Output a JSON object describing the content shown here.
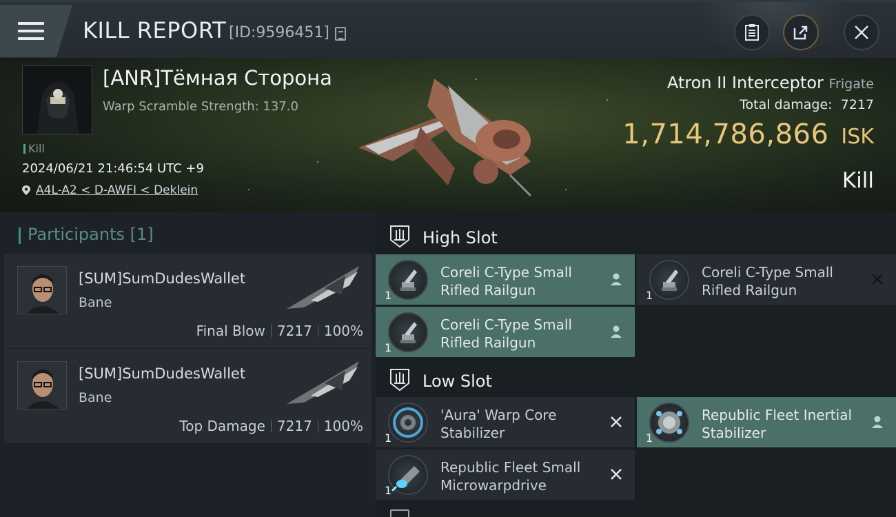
{
  "header": {
    "title": "KILL REPORT",
    "kill_id": "[ID:9596451]",
    "menu_icon": "hamburger-menu-icon",
    "buttons": [
      {
        "icon": "clipboard-icon"
      },
      {
        "icon": "share-icon"
      },
      {
        "icon": "close-icon"
      }
    ]
  },
  "victim": {
    "name": "[ANR]Тёмная Сторона",
    "subtitle": "Warp Scramble Strength: 137.0",
    "kill_tag": "Kill",
    "timestamp": "2024/06/21 21:46:54 UTC +9",
    "location": "A4L-A2 < D-AWFI < Deklein",
    "ship_name": "Atron II Interceptor",
    "ship_class": "Frigate",
    "total_damage_label": "Total damage:",
    "total_damage": "7217",
    "isk_value": "1,714,786,866",
    "isk_unit": "ISK",
    "result": "Kill"
  },
  "participants": {
    "title": "Participants",
    "count": "[1]",
    "items": [
      {
        "name": "[SUM]SumDudesWallet",
        "ship": "Bane",
        "role": "Final Blow",
        "damage": "7217",
        "percent": "100%"
      },
      {
        "name": "[SUM]SumDudesWallet",
        "ship": "Bane",
        "role": "Top Damage",
        "damage": "7217",
        "percent": "100%"
      }
    ]
  },
  "fitting": {
    "high_slot_label": "High Slot",
    "low_slot_label": "Low Slot",
    "high": [
      {
        "name": "Coreli C-Type Small Rifled Railgun",
        "qty": "1",
        "status": "person-icon",
        "active": true
      },
      {
        "name": "Coreli C-Type Small Rifled Railgun",
        "qty": "1",
        "status": "x-icon",
        "active": false
      },
      {
        "name": "Coreli C-Type Small Rifled Railgun",
        "qty": "1",
        "status": "person-icon",
        "active": true
      }
    ],
    "low": [
      {
        "name": "'Aura' Warp Core Stabilizer",
        "qty": "1",
        "status": "x-icon",
        "active": false
      },
      {
        "name": "Republic Fleet Inertial Stabilizer",
        "qty": "1",
        "status": "person-icon",
        "active": true
      },
      {
        "name": "Republic Fleet Small Microwarpdrive",
        "qty": "1",
        "status": "x-icon",
        "active": false
      }
    ]
  },
  "colors": {
    "accent_teal": "#4b6f69",
    "isk_gold": "#e9c77a",
    "background": "#1c2127"
  }
}
